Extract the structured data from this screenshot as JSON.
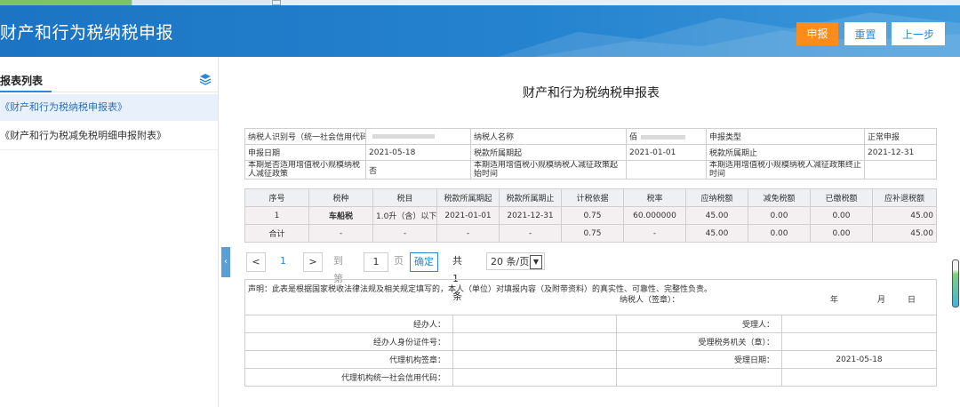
{
  "header": {
    "title": "财产和行为税纳税申报",
    "buttons": {
      "submit": "申报",
      "reset": "重置",
      "prev": "上一步"
    }
  },
  "sidebar": {
    "heading": "报表列表",
    "items": [
      {
        "label": "《财产和行为税纳税申报表》"
      },
      {
        "label": "《财产和行为税减免税明细申报附表》"
      }
    ]
  },
  "form": {
    "title": "财产和行为税纳税申报表",
    "info": {
      "taxpayer_id_label": "纳税人识别号（统一社会信用代码）",
      "taxpayer_name_label": "纳税人名称",
      "taxpayer_name_value": "佰",
      "declare_type_label": "申报类型",
      "declare_type_value": "正常申报",
      "declare_date_label": "申报日期",
      "declare_date_value": "2021-05-18",
      "period_start_label": "税款所属期起",
      "period_start_value": "2021-01-01",
      "period_end_label": "税款所属期止",
      "period_end_value": "2021-12-31",
      "small_scale_label": "本期是否适用增值税小规模纳税人减征政策",
      "small_scale_value": "否",
      "policy_start_label": "本期适用增值税小规模纳税人减征政策起始时间",
      "policy_end_label": "本期适用增值税小规模纳税人减征政策终止时间"
    },
    "columns": [
      "序号",
      "税种",
      "税目",
      "税款所属期起",
      "税款所属期止",
      "计税依据",
      "税率",
      "应纳税额",
      "减免税额",
      "已缴税额",
      "应补退税额"
    ],
    "rows": [
      [
        "1",
        "车船税",
        "1.0升（含）以下",
        "2021-01-01",
        "2021-12-31",
        "0.75",
        "60.000000",
        "45.00",
        "0.00",
        "0.00",
        "45.00"
      ]
    ],
    "total": [
      "合计",
      "-",
      "-",
      "-",
      "-",
      "0.75",
      "-",
      "45.00",
      "0.00",
      "0.00",
      "45.00"
    ],
    "pager": {
      "prev": "<",
      "current": "1",
      "next": ">",
      "goto_label": "到第",
      "goto_value": "1",
      "page_label": "页",
      "confirm": "确定",
      "total": "共1条",
      "page_size": "20 条/页"
    },
    "declaration": {
      "statement": "声明：此表是根据国家税收法律法规及相关规定填写的，本人（单位）对填报内容（及附带资料）的真实性、可靠性、完整性负责。",
      "sign_label": "纳税人（签章）：",
      "year": "年",
      "month": "月",
      "day": "日",
      "agent_label": "经办人：",
      "receiver_label": "受理人：",
      "agent_id_label": "经办人身份证件号：",
      "tax_office_label": "受理税务机关（章）：",
      "org_seal_label": "代理机构签章：",
      "accept_date_label": "受理日期：",
      "accept_date_value": "2021-05-18",
      "org_code_label": "代理机构统一社会信用代码："
    }
  }
}
